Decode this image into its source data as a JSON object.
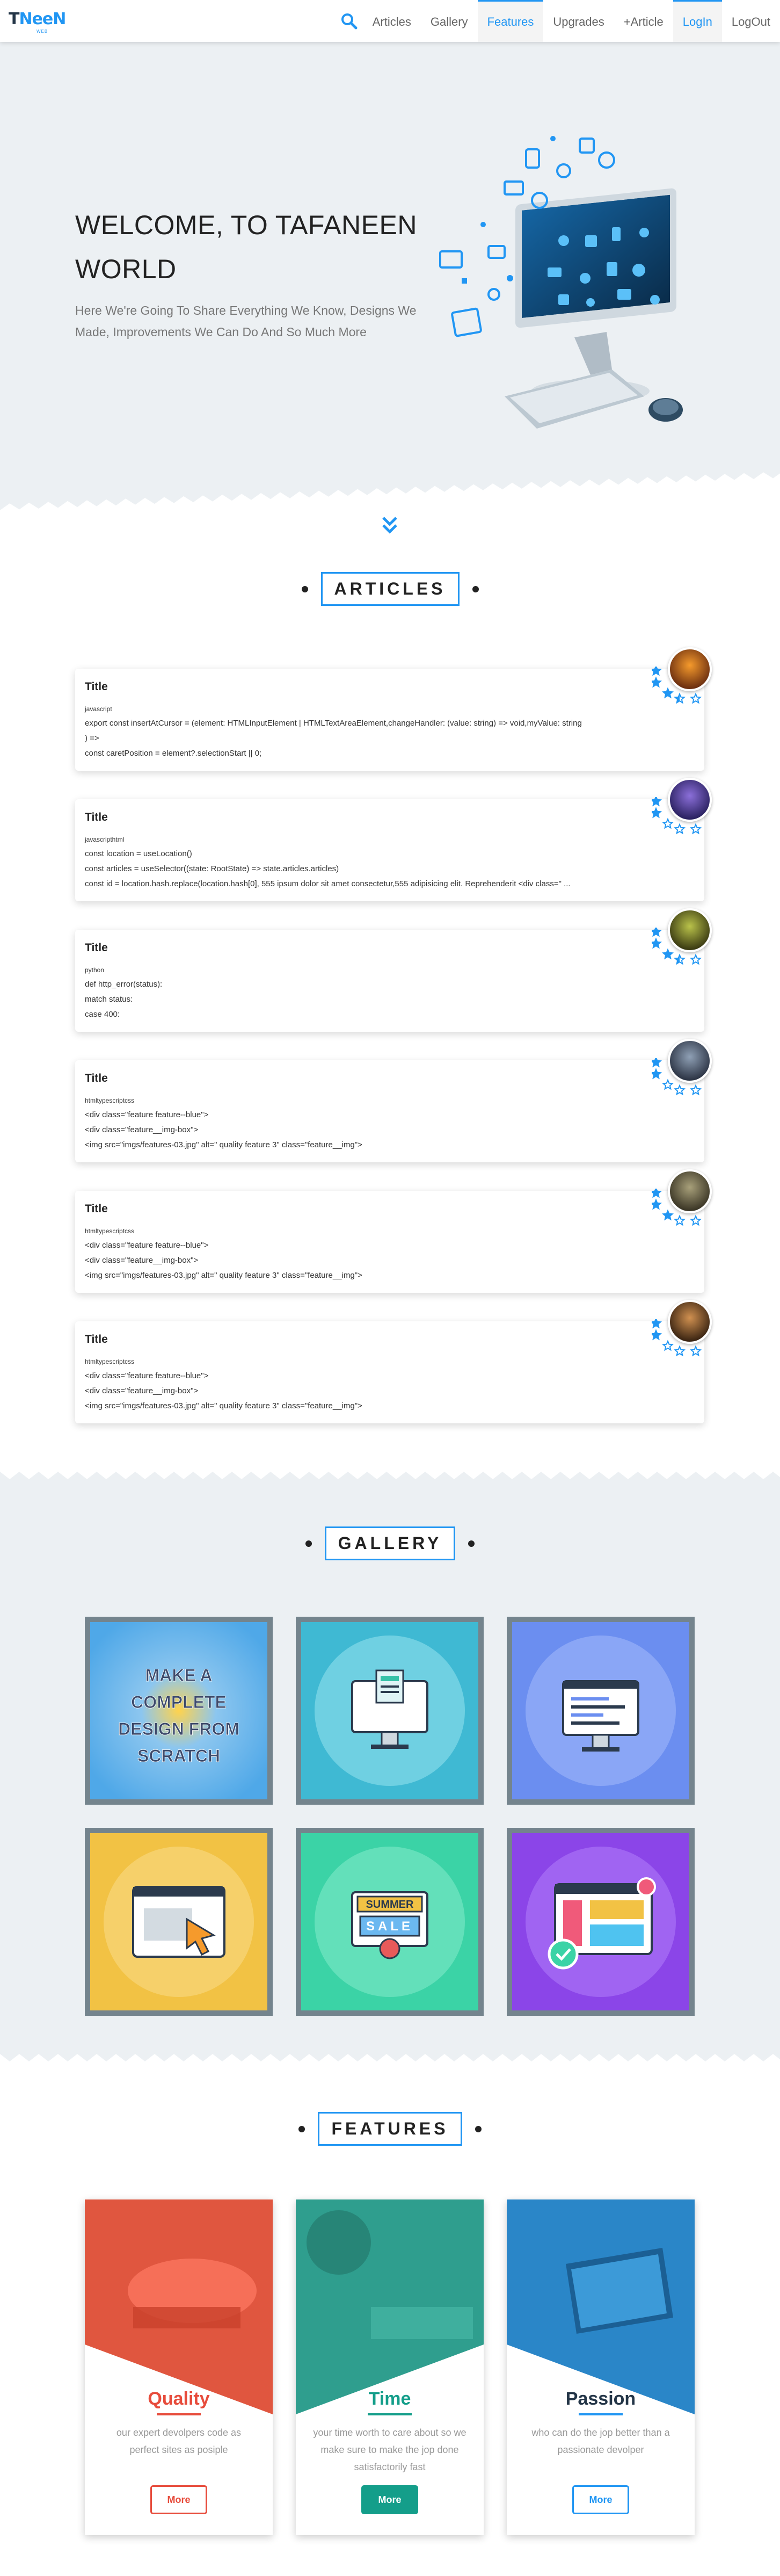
{
  "nav": {
    "logo": "TNeeN",
    "logo_sub": "WEB",
    "links": [
      "Articles",
      "Gallery",
      "Features",
      "Upgrades",
      "+Article",
      "LogIn",
      "LogOut"
    ]
  },
  "hero": {
    "title": "WELCOME, TO TAFANEEN WORLD",
    "description": "Here We're Going To Share Everything We Know, Designs We Made, Improvements We Can Do And So Much More"
  },
  "articles": {
    "heading": "ARTICLES",
    "items": [
      {
        "title": "Title",
        "lang": "javascript",
        "lines": [
          "export const insertAtCursor = (element: HTMLInputElement | HTMLTextAreaElement,changeHandler: (value: string) => void,myValue: string",
          ") =>",
          "const caretPosition = element?.selectionStart || 0;"
        ],
        "stars": 3.5
      },
      {
        "title": "Title",
        "lang": "javascripthtml",
        "lines": [
          "const location = useLocation()",
          "const articles = useSelector((state: RootState) => state.articles.articles)",
          "const id = location.hash.replace(location.hash[0], 555 ipsum dolor sit amet consectetur,555 adipisicing elit. Reprehenderit <div class=\" ..."
        ],
        "stars": 2
      },
      {
        "title": "Title",
        "lang": "python",
        "lines": [
          "def http_error(status):",
          "match status:",
          "case 400:"
        ],
        "stars": 3.5
      },
      {
        "title": "Title",
        "lang": "htmltypescriptcss",
        "lines": [
          "<div class=\"feature feature--blue\">",
          "<div class=\"feature__img-box\">",
          "<img src=\"imgs/features-03.jpg\" alt=\" quality feature 3\" class=\"feature__img\">"
        ],
        "stars": 2
      },
      {
        "title": "Title",
        "lang": "htmltypescriptcss",
        "lines": [
          "<div class=\"feature feature--blue\">",
          "<div class=\"feature__img-box\">",
          "<img src=\"imgs/features-03.jpg\" alt=\" quality feature 3\" class=\"feature__img\">"
        ],
        "stars": 3
      },
      {
        "title": "Title",
        "lang": "htmltypescriptcss",
        "lines": [
          "<div class=\"feature feature--blue\">",
          "<div class=\"feature__img-box\">",
          "<img src=\"imgs/features-03.jpg\" alt=\" quality feature 3\" class=\"feature__img\">"
        ],
        "stars": 2
      }
    ]
  },
  "gallery": {
    "heading": "GALLERY",
    "tile1_text": [
      "MAKE A",
      "COMPLETE",
      "DESIGN FROM",
      "SCRATCH"
    ],
    "tile5_text": [
      "SUMMER",
      "SALE"
    ]
  },
  "features": {
    "heading": "FEATURES",
    "items": [
      {
        "title": "Quality",
        "text": "our expert devolpers code as perfect sites as posiple",
        "button": "More",
        "color": "#e74c3c"
      },
      {
        "title": "Time",
        "text": "your time worth to care about so we make sure to make the jop done satisfactorily fast",
        "button": "More",
        "color": "#149e8a"
      },
      {
        "title": "Passion",
        "text": "who can do the jop better than a passionate devolper",
        "button": "More",
        "color": "#2196f3"
      }
    ]
  }
}
